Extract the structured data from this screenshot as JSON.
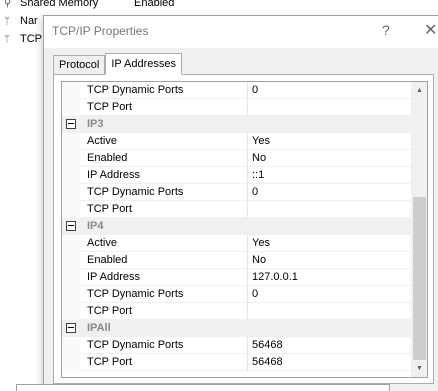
{
  "background": {
    "rows": [
      {
        "glyph": "plug-icon",
        "name": "Shared Memory",
        "value": "Enabled"
      },
      {
        "glyph": "pipe-icon",
        "name": "Nar",
        "value": ""
      },
      {
        "glyph": "network-icon",
        "name": "TCP",
        "value": ""
      }
    ]
  },
  "dialog": {
    "title": "TCP/IP Properties",
    "help_label": "?",
    "close_label": "✕",
    "tabs": [
      {
        "label": "Protocol",
        "active": false
      },
      {
        "label": "IP Addresses",
        "active": true
      }
    ]
  },
  "grid": {
    "rows": [
      {
        "type": "prop",
        "name": "TCP Dynamic Ports",
        "value": "0"
      },
      {
        "type": "prop",
        "name": "TCP Port",
        "value": ""
      },
      {
        "type": "category",
        "name": "IP3"
      },
      {
        "type": "prop",
        "name": "Active",
        "value": "Yes"
      },
      {
        "type": "prop",
        "name": "Enabled",
        "value": "No"
      },
      {
        "type": "prop",
        "name": "IP Address",
        "value": "::1"
      },
      {
        "type": "prop",
        "name": "TCP Dynamic Ports",
        "value": "0"
      },
      {
        "type": "prop",
        "name": "TCP Port",
        "value": ""
      },
      {
        "type": "category",
        "name": "IP4"
      },
      {
        "type": "prop",
        "name": "Active",
        "value": "Yes"
      },
      {
        "type": "prop",
        "name": "Enabled",
        "value": "No"
      },
      {
        "type": "prop",
        "name": "IP Address",
        "value": "127.0.0.1"
      },
      {
        "type": "prop",
        "name": "TCP Dynamic Ports",
        "value": "0"
      },
      {
        "type": "prop",
        "name": "TCP Port",
        "value": ""
      },
      {
        "type": "category",
        "name": "IPAll"
      },
      {
        "type": "prop",
        "name": "TCP Dynamic Ports",
        "value": "56468"
      },
      {
        "type": "prop",
        "name": "TCP Port",
        "value": "56468"
      }
    ]
  },
  "scrollbar": {
    "up": "▲",
    "down": "▼"
  }
}
